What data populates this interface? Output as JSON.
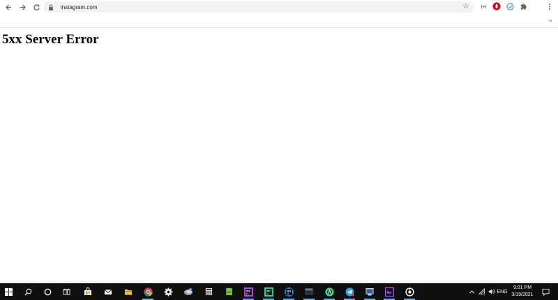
{
  "browser": {
    "url": "instagram.com",
    "bookmarks_overflow": "»"
  },
  "page": {
    "heading": "5xx Server Error"
  },
  "taskbar": {
    "apps": [
      "start",
      "search",
      "cortana",
      "task-view",
      "store",
      "mail",
      "file-explorer",
      "chrome",
      "settings",
      "edge",
      "calculator",
      "notepad",
      "phpstorm",
      "pycharm",
      "goland",
      "app-window",
      "android-studio",
      "telegram",
      "cmd-window",
      "adobe-animate",
      "gitkraken"
    ],
    "language": "ENG",
    "time": "9:01 PM",
    "date": "3/19/2021"
  },
  "colors": {
    "taskbar_bg": "#0f0f10",
    "omnibox_bg": "#f1f3f4",
    "icon_gray": "#5f6368"
  }
}
